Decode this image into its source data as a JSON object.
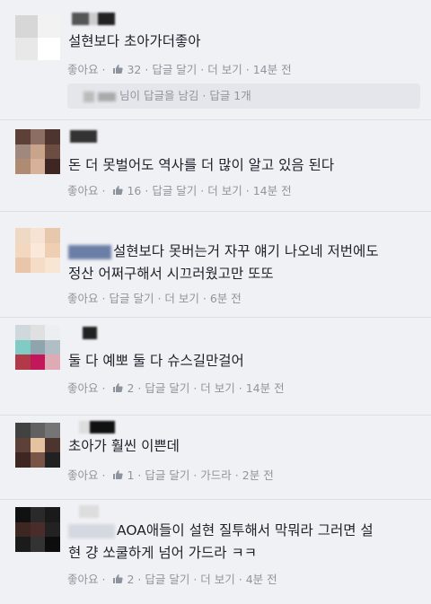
{
  "comments": [
    {
      "text": "설현보다 초아가더좋아",
      "like": "좋아요",
      "like_count": "32",
      "reply": "답글 달기",
      "more": "더 보기",
      "time": "14분 전",
      "reply_summary": "님이 답글을 남김 · 답글 1개"
    },
    {
      "text": "돈 더 못벌어도 역사를 더 많이 알고 있음 된다",
      "like": "좋아요",
      "like_count": "16",
      "reply": "답글 달기",
      "more": "더 보기",
      "time": "14분 전"
    },
    {
      "text": "설현보다 못버는거 자꾸 얘기 나오네 저번에도",
      "text2": "정산 어쩌구해서 시끄러웠고만 또또",
      "like": "좋아요",
      "reply": "답글 달기",
      "more": "더 보기",
      "time": "6분 전"
    },
    {
      "text": "둘 다 예뽀 둘 다 슈스길만걸어",
      "like": "좋아요",
      "like_count": "2",
      "reply": "답글 달기",
      "more": "더 보기",
      "time": "14분 전"
    },
    {
      "text": "초아가 훨씬 이쁜데",
      "like": "좋아요",
      "like_count": "1",
      "reply": "답글 달기",
      "more": "가드라",
      "time": "2분 전"
    },
    {
      "text": "AOA애들이 설현 질투해서 막뭐라 그러면 설",
      "text2": "현 걍 쏘쿨하게 넘어 가드라 ㅋㅋ",
      "like": "좋아요",
      "like_count": "2",
      "reply": "답글 달기",
      "more": "더 보기",
      "time": "4분 전"
    }
  ],
  "separator": "·",
  "colors": {
    "background": "#f0f1f5",
    "meta": "#90949c",
    "like_icon": "#8d949e"
  }
}
